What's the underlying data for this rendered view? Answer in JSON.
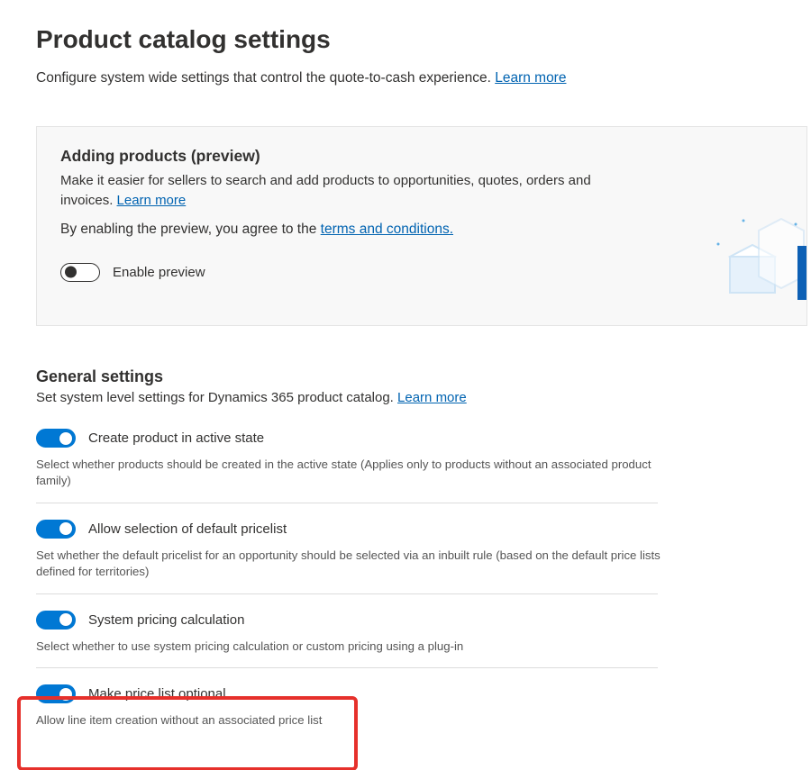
{
  "header": {
    "title": "Product catalog settings",
    "subtitle": "Configure system wide settings that control the quote-to-cash experience.",
    "learn_more": "Learn more"
  },
  "preview_card": {
    "heading": "Adding products (preview)",
    "desc_line1": "Make it easier for sellers to search and add products to opportunities, quotes, orders and invoices.",
    "learn_more": "Learn more",
    "terms_prefix": "By enabling the preview, you agree to the ",
    "terms_link": "terms and conditions.",
    "toggle_label": "Enable preview",
    "toggle_on": false
  },
  "general": {
    "heading": "General settings",
    "sub": "Set system level settings for Dynamics 365 product catalog.",
    "learn_more": "Learn more",
    "settings": [
      {
        "label": "Create product in active state",
        "help": "Select whether products should be created in the active state (Applies only to products without an associated product family)",
        "on": true
      },
      {
        "label": "Allow selection of default pricelist",
        "help": "Set whether the default pricelist for an opportunity should be selected via an inbuilt rule (based on the default price lists defined for territories)",
        "on": true
      },
      {
        "label": "System pricing calculation",
        "help": "Select whether to use system pricing calculation or custom pricing using a plug-in",
        "on": true
      },
      {
        "label": "Make price list optional",
        "help": "Allow line item creation without an associated price list",
        "on": true
      }
    ]
  }
}
